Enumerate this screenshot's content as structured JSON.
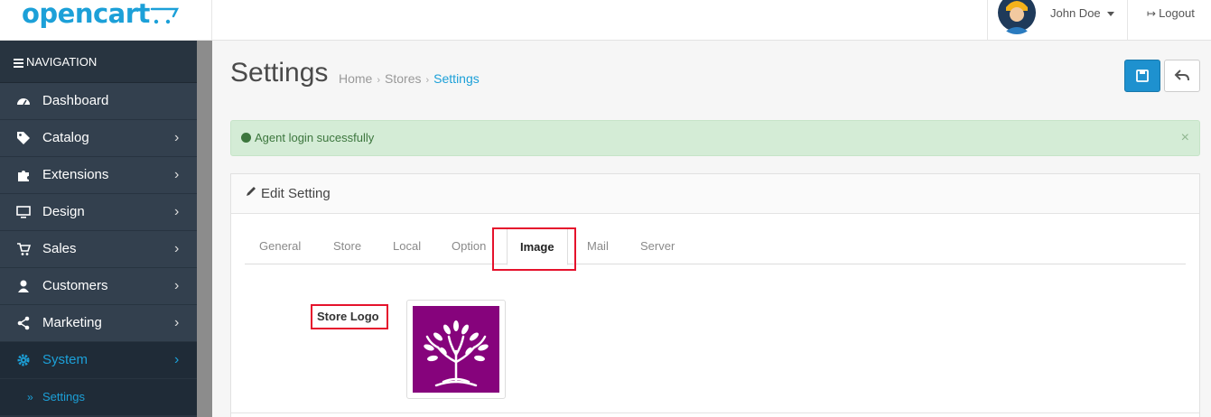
{
  "header": {
    "logo_text": "opencart",
    "user_name": "John Doe",
    "logout_label": "Logout"
  },
  "sidebar": {
    "heading": "NAVIGATION",
    "items": [
      {
        "label": "Dashboard",
        "icon": "dashboard-icon"
      },
      {
        "label": "Catalog",
        "icon": "tags-icon"
      },
      {
        "label": "Extensions",
        "icon": "puzzle-icon"
      },
      {
        "label": "Design",
        "icon": "monitor-icon"
      },
      {
        "label": "Sales",
        "icon": "cart-icon"
      },
      {
        "label": "Customers",
        "icon": "user-icon"
      },
      {
        "label": "Marketing",
        "icon": "share-icon"
      },
      {
        "label": "System",
        "icon": "gear-icon"
      }
    ],
    "sub_item": "Settings"
  },
  "page": {
    "title": "Settings",
    "breadcrumb": [
      "Home",
      "Stores",
      "Settings"
    ]
  },
  "alert": {
    "message": "Agent login sucessfully",
    "close": "×"
  },
  "panel": {
    "title": "Edit Setting",
    "tabs": [
      "General",
      "Store",
      "Local",
      "Option",
      "Image",
      "Mail",
      "Server"
    ],
    "active_tab": "Image",
    "field_label": "Store Logo"
  },
  "colors": {
    "accent": "#1ca0d8",
    "sidebar": "#2a3542",
    "alert_bg": "#d4ecd6",
    "highlight": "#e5122c",
    "logo_bg": "#86037c"
  }
}
